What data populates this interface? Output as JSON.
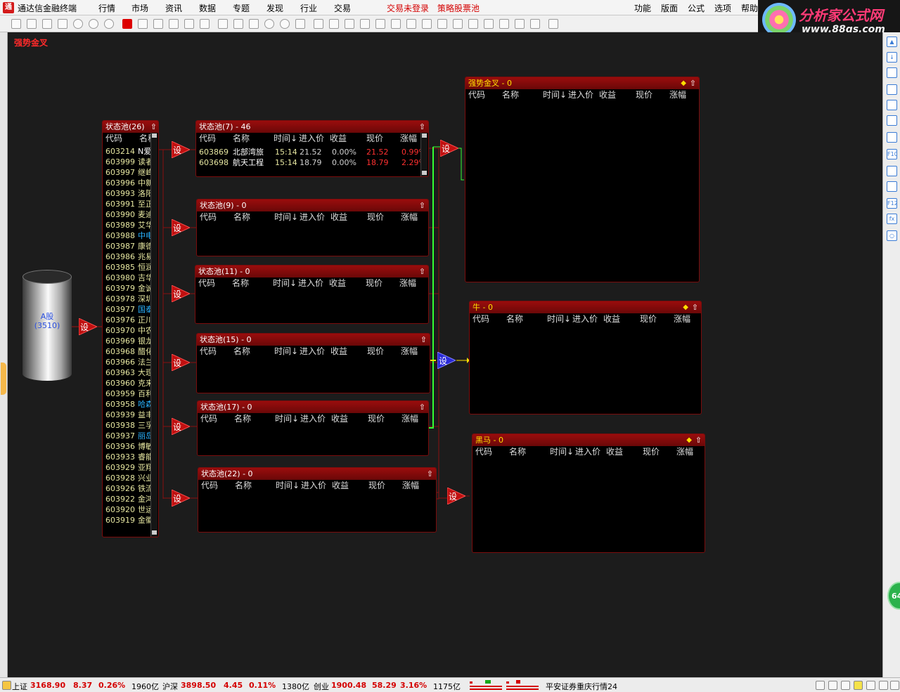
{
  "app": {
    "logo_text": "通",
    "title": "通达信金融终端",
    "menus": [
      "行情",
      "市场",
      "资讯",
      "数据",
      "专题",
      "发现",
      "行业",
      "交易"
    ],
    "alerts": [
      "交易未登录",
      "策略股票池"
    ],
    "right_menus": [
      "功能",
      "版面",
      "公式",
      "选项",
      "帮助"
    ]
  },
  "ad": {
    "title": "分析家公式网",
    "url": "www.88gs.com"
  },
  "strategy": {
    "title": "强势金叉"
  },
  "source": {
    "name": "A股",
    "count": "(3510)"
  },
  "set_label": "设",
  "columns": [
    "代码",
    "名称",
    "时间↓",
    "进入价",
    "收益",
    "现价",
    "涨幅"
  ],
  "main_pool": {
    "title": "状态池(26)",
    "col_code": "代码",
    "col_name": "名称",
    "rows": [
      {
        "code": "603214",
        "name": "N爱",
        "hl": "white"
      },
      {
        "code": "603999",
        "name": "读者",
        "hl": ""
      },
      {
        "code": "603997",
        "name": "继峰",
        "hl": ""
      },
      {
        "code": "603996",
        "name": "中新",
        "hl": ""
      },
      {
        "code": "603993",
        "name": "洛阳",
        "hl": ""
      },
      {
        "code": "603991",
        "name": "至正",
        "hl": ""
      },
      {
        "code": "603990",
        "name": "麦迪",
        "hl": ""
      },
      {
        "code": "603989",
        "name": "艾华",
        "hl": ""
      },
      {
        "code": "603988",
        "name": "中电",
        "hl": "cyan"
      },
      {
        "code": "603987",
        "name": "康德",
        "hl": ""
      },
      {
        "code": "603986",
        "name": "兆易",
        "hl": ""
      },
      {
        "code": "603985",
        "name": "恒润",
        "hl": ""
      },
      {
        "code": "603980",
        "name": "吉华",
        "hl": ""
      },
      {
        "code": "603979",
        "name": "金诚",
        "hl": ""
      },
      {
        "code": "603978",
        "name": "深圳",
        "hl": ""
      },
      {
        "code": "603977",
        "name": "国泰",
        "hl": "cyan"
      },
      {
        "code": "603976",
        "name": "正川",
        "hl": ""
      },
      {
        "code": "603970",
        "name": "中农",
        "hl": ""
      },
      {
        "code": "603969",
        "name": "银龙",
        "hl": ""
      },
      {
        "code": "603968",
        "name": "醋化",
        "hl": ""
      },
      {
        "code": "603966",
        "name": "法兰",
        "hl": ""
      },
      {
        "code": "603963",
        "name": "大理",
        "hl": ""
      },
      {
        "code": "603960",
        "name": "克来",
        "hl": ""
      },
      {
        "code": "603959",
        "name": "百利",
        "hl": ""
      },
      {
        "code": "603958",
        "name": "哈森",
        "hl": "cyan"
      },
      {
        "code": "603939",
        "name": "益丰",
        "hl": ""
      },
      {
        "code": "603938",
        "name": "三孚",
        "hl": ""
      },
      {
        "code": "603937",
        "name": "丽岛",
        "hl": "cyan"
      },
      {
        "code": "603936",
        "name": "博敏",
        "hl": ""
      },
      {
        "code": "603933",
        "name": "睿能",
        "hl": ""
      },
      {
        "code": "603929",
        "name": "亚翔",
        "hl": ""
      },
      {
        "code": "603928",
        "name": "兴业",
        "hl": ""
      },
      {
        "code": "603926",
        "name": "铁流",
        "hl": ""
      },
      {
        "code": "603922",
        "name": "金鸿",
        "hl": ""
      },
      {
        "code": "603920",
        "name": "世运",
        "hl": ""
      },
      {
        "code": "603919",
        "name": "金徽",
        "hl": ""
      }
    ]
  },
  "pools": [
    {
      "id": "p7",
      "title": "状态池(7) - 46",
      "rows": [
        {
          "code": "603869",
          "name": "北部湾旅",
          "time": "15:14",
          "entry": "21.52",
          "ret": "0.00%",
          "price": "21.52",
          "chg": "0.99%"
        },
        {
          "code": "603698",
          "name": "航天工程",
          "time": "15:14",
          "entry": "18.79",
          "ret": "0.00%",
          "price": "18.79",
          "chg": "2.29%"
        }
      ]
    },
    {
      "id": "p9",
      "title": "状态池(9) - 0",
      "rows": []
    },
    {
      "id": "p11",
      "title": "状态池(11) - 0",
      "rows": []
    },
    {
      "id": "p15",
      "title": "状态池(15) - 0",
      "rows": []
    },
    {
      "id": "p17",
      "title": "状态池(17) - 0",
      "rows": []
    },
    {
      "id": "p22",
      "title": "状态池(22) - 0",
      "rows": []
    }
  ],
  "outputs": [
    {
      "id": "qsjc",
      "title": "强势金叉 - 0"
    },
    {
      "id": "niu",
      "title": "牛 - 0"
    },
    {
      "id": "heima",
      "title": "黑马 - 0"
    }
  ],
  "status": {
    "sh_label": "上证",
    "sh_val": "3168.90",
    "sh_chg": "8.37",
    "sh_pct": "0.26%",
    "sh_amt": "1960亿",
    "hs_label": "沪深",
    "hs_val": "3898.50",
    "hs_chg": "4.45",
    "hs_pct": "0.11%",
    "hs_amt": "1380亿",
    "cy_label": "创业",
    "cy_val": "1900.48",
    "cy_chg": "58.29",
    "cy_pct": "3.16%",
    "cy_amt": "1175亿",
    "broker": "平安证券重庆行情24"
  },
  "green_badge": "64"
}
